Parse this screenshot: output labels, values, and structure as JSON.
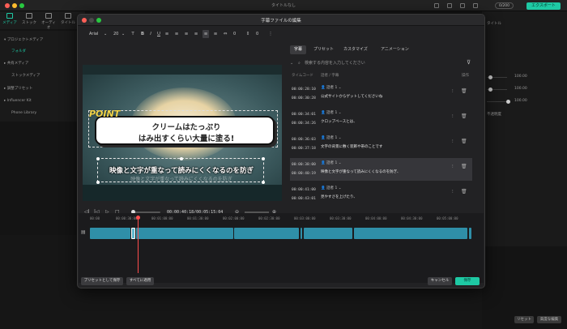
{
  "app": {
    "title": "タイトルなし",
    "export_label": "エクスポート",
    "credit": "0/200"
  },
  "tabs": [
    {
      "label": "メディア"
    },
    {
      "label": "ストック"
    },
    {
      "label": "オーディオ"
    },
    {
      "label": "タイトル"
    }
  ],
  "sidebar": {
    "items": [
      {
        "label": "▾ プロジェクトメディア"
      },
      {
        "label": "フォルダ"
      },
      {
        "label": "▸ 共有メディア"
      },
      {
        "label": "ストックメディア"
      },
      {
        "label": "▸ 調整プリセット"
      },
      {
        "label": "▸ Influencer Kit"
      },
      {
        "label": "Phone Library"
      }
    ]
  },
  "right_panel": {
    "label_top": "タイトル",
    "val1": "100.00",
    "val2": "100.00",
    "val3": "100.00",
    "label_mid": "不透明度",
    "btn_reset": "リセット",
    "btn_advanced": "高度な編集"
  },
  "modal": {
    "title": "字幕ファイルの編集",
    "toolbar": {
      "font": "Arial",
      "size": "20",
      "spacing": "0",
      "line_spacing": "0"
    },
    "preview": {
      "point_tag": "POINT",
      "bubble_line1": "クリームはたっぷり",
      "bubble_line2": "はみ出すくらい大量に塗る!",
      "subtitle": "映像と文字が重なって読みにくくなるのを防ぎ",
      "subtitle_shadow": "映像と文字が重なって読みにくくなるのを防ぎ"
    },
    "player": {
      "time": "00:00:40:18/00:05:15:04"
    },
    "panel_tabs": [
      {
        "label": "字幕"
      },
      {
        "label": "プリセット"
      },
      {
        "label": "カスタマイズ"
      },
      {
        "label": "アニメーション"
      }
    ],
    "search_placeholder": "検索する内容を入力してください",
    "list_head": {
      "timecode": "タイムコード",
      "speaker": "話者 / 字幕",
      "ops": "操作"
    },
    "rows": [
      {
        "start": "00:00:28:10",
        "end": "00:00:30:28",
        "speaker": "話者 1",
        "text": "公式サイトからゲットしてくださいね"
      },
      {
        "start": "00:00:34:01",
        "end": "00:00:34:26",
        "speaker": "話者 1",
        "text": "クロップベースとは、"
      },
      {
        "start": "00:00:36:03",
        "end": "00:00:37:18",
        "speaker": "話者 1",
        "text": "文字の背景に敷く装飾や帯のことです"
      },
      {
        "start": "00:00:38:00",
        "end": "00:00:40:19",
        "speaker": "話者 1",
        "text": "映像と文字が重なって読みにくくなるのを防ぎ、"
      },
      {
        "start": "00:00:41:00",
        "end": "00:00:43:01",
        "speaker": "話者 1",
        "text": "見やすさを上げたり、"
      }
    ],
    "timeline": {
      "ruler": [
        "00:00",
        "00:00:30:00",
        "00:01:00:00",
        "00:01:30:00",
        "00:02:00:00",
        "00:02:30:00",
        "00:03:00:00",
        "00:03:30:00",
        "00:04:00:00",
        "00:04:30:00",
        "00:05:00:00"
      ]
    },
    "footer": {
      "save_preset": "プリセットとして保存",
      "apply_all": "すべてに適用",
      "cancel": "キャンセル",
      "save": "保存"
    }
  },
  "colors": {
    "accent": "#1ec9a4",
    "clip": "#2f8fa8",
    "playhead": "#ff4d4d"
  }
}
